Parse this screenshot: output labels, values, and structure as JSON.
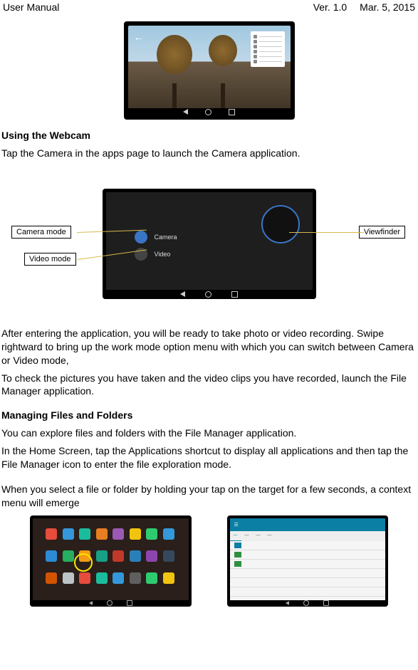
{
  "header": {
    "left": "User Manual",
    "ver": "Ver. 1.0",
    "date": "Mar. 5, 2015"
  },
  "sec1": {
    "title": "Using the Webcam",
    "intro": "Tap the Camera in the apps page to launch the Camera application."
  },
  "callouts": {
    "camera_mode": "Camera mode",
    "video_mode": "Video mode",
    "viewfinder": "Viewfinder",
    "opt_camera": "Camera",
    "opt_video": "Video"
  },
  "para": {
    "p1": "After entering the application, you will be ready to take photo or video recording. Swipe rightward to bring up the work mode option menu with which you can switch between Camera or Video mode,",
    "p2": "To check the pictures you have taken and the video clips you have recorded, launch the File Manager application."
  },
  "sec2": {
    "title": "Managing Files and Folders",
    "p1": "You can explore files and folders with the File Manager application.",
    "p2": "In the Home Screen, tap the Applications shortcut to display all applications and then tap the File Manager icon to enter the file exploration mode.",
    "p3": "When you select a file or folder by holding your tap on the target for a few seconds, a context menu will emerge"
  }
}
